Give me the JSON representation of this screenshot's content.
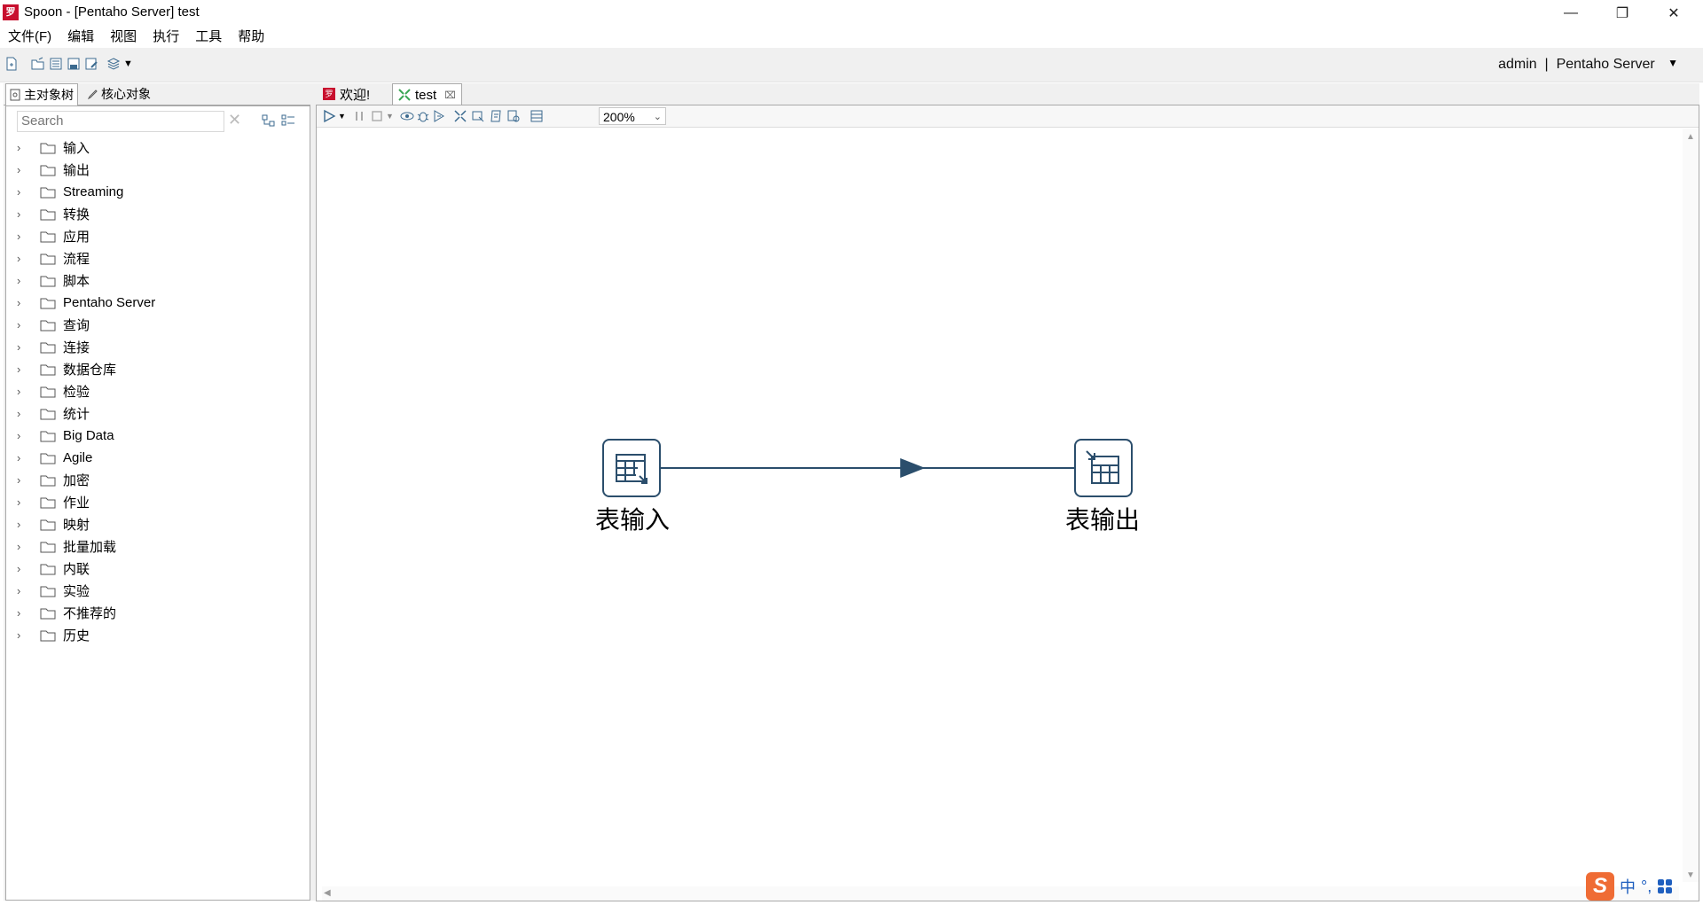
{
  "window": {
    "title": "Spoon - [Pentaho Server] test",
    "app_icon": "spoon-logo-icon"
  },
  "menu": [
    {
      "label": "文件(F)"
    },
    {
      "label": "编辑"
    },
    {
      "label": "视图"
    },
    {
      "label": "执行"
    },
    {
      "label": "工具"
    },
    {
      "label": "帮助"
    }
  ],
  "toolbar": {
    "icons": [
      "new-file-icon",
      "open-file-icon",
      "explore-repository-icon",
      "save-icon",
      "save-as-icon",
      "perspective-icon"
    ],
    "user": "admin",
    "separator": "|",
    "server": "Pentaho Server"
  },
  "left_panel": {
    "tabs": [
      {
        "label": "主对象树",
        "icon": "object-tree-icon"
      },
      {
        "label": "核心对象",
        "icon": "pencil-icon"
      }
    ],
    "search_placeholder": "Search",
    "tree": [
      {
        "label": "输入"
      },
      {
        "label": "输出"
      },
      {
        "label": "Streaming"
      },
      {
        "label": "转换"
      },
      {
        "label": "应用"
      },
      {
        "label": "流程"
      },
      {
        "label": "脚本"
      },
      {
        "label": "Pentaho Server"
      },
      {
        "label": "查询"
      },
      {
        "label": "连接"
      },
      {
        "label": "数据仓库"
      },
      {
        "label": "检验"
      },
      {
        "label": "统计"
      },
      {
        "label": "Big Data"
      },
      {
        "label": "Agile"
      },
      {
        "label": "加密"
      },
      {
        "label": "作业"
      },
      {
        "label": "映射"
      },
      {
        "label": "批量加载"
      },
      {
        "label": "内联"
      },
      {
        "label": "实验"
      },
      {
        "label": "不推荐的"
      },
      {
        "label": "历史"
      }
    ]
  },
  "editor": {
    "tabs": [
      {
        "label": "欢迎!",
        "icon": "welcome-icon"
      },
      {
        "label": "test",
        "icon": "transformation-icon",
        "closable": true
      }
    ],
    "zoom": "200%",
    "canvas_toolbar_icons": [
      "run-icon",
      "run-dropdown-icon",
      "pause-icon",
      "stop-icon",
      "stop-dropdown-icon",
      "preview-icon",
      "debug-icon",
      "replay-icon",
      "verify-icon",
      "impact-icon",
      "sql-icon",
      "explore-db-icon",
      "show-results-icon"
    ],
    "steps": [
      {
        "label": "表输入",
        "icon": "table-input-icon"
      },
      {
        "label": "表输出",
        "icon": "table-output-icon"
      }
    ],
    "hop_color": "#2b4e6c"
  },
  "ime": {
    "logo": "S",
    "mode": "中",
    "punct": "°,"
  }
}
